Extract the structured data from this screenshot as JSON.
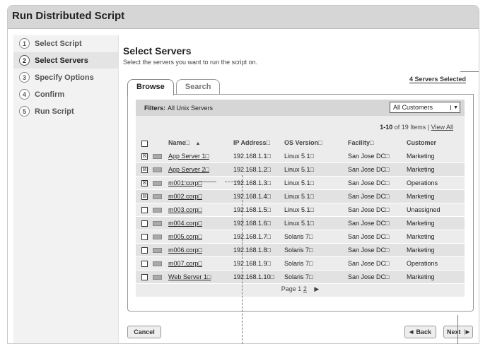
{
  "window": {
    "title": "Run Distributed Script"
  },
  "sidebar": {
    "steps": [
      {
        "num": "1",
        "label": "Select Script"
      },
      {
        "num": "2",
        "label": "Select Servers"
      },
      {
        "num": "3",
        "label": "Specify Options"
      },
      {
        "num": "4",
        "label": "Confirm"
      },
      {
        "num": "5",
        "label": "Run Script"
      }
    ]
  },
  "main": {
    "title": "Select Servers",
    "subtitle": "Select the servers you want to run the script on.",
    "selected_count": "4 Servers Selected",
    "tabs": [
      {
        "label": "Browse"
      },
      {
        "label": "Search"
      }
    ],
    "filter": {
      "label": "Filters:",
      "value": "All Unix Servers",
      "customer_select": "All Customers",
      "customer_arrow": "▼"
    },
    "paging": {
      "range": "1-10",
      "of_text": "of 19 Items",
      "separator": "|",
      "view_all": "View All"
    },
    "columns": {
      "name": "Name□",
      "sort_icon": "▲",
      "ip": "IP Address□",
      "os": "OS Version□",
      "facility": "Facility□",
      "customer": "Customer"
    },
    "rows": [
      {
        "checked": "☒",
        "name": "App Server 1□",
        "ip": "192.168.1.1□",
        "os": "Linux 5.1□",
        "facility": "San Jose DC□",
        "customer": "Marketing"
      },
      {
        "checked": "☒",
        "name": "App Server 2□",
        "ip": "192.168.1.2□",
        "os": "Linux 5.1□",
        "facility": "San Jose DC□",
        "customer": "Marketing"
      },
      {
        "checked": "☒",
        "name": "m001.corp□",
        "ip": "192.168.1.3□",
        "os": "Linux 5.1□",
        "facility": "San Jose DC□",
        "customer": "Operations"
      },
      {
        "checked": "☒",
        "name": "m002.corp□",
        "ip": "192.168.1.4□",
        "os": "Linux 5.1□",
        "facility": "San Jose DC□",
        "customer": "Marketing"
      },
      {
        "checked": "",
        "name": "m003.corp□",
        "ip": "192.168.1.5□",
        "os": "Linux 5.1□",
        "facility": "San Jose DC□",
        "customer": "Unassigned"
      },
      {
        "checked": "",
        "name": "m004.corp□",
        "ip": "192.168.1.6□",
        "os": "Linux 5.1□",
        "facility": "San Jose DC□",
        "customer": "Marketing"
      },
      {
        "checked": "",
        "name": "m005.corp□",
        "ip": "192.168.1.7□",
        "os": "Solaris 7□",
        "facility": "San Jose DC□",
        "customer": "Marketing"
      },
      {
        "checked": "",
        "name": "m006.corp□",
        "ip": "192.168.1.8□",
        "os": "Solaris 7□",
        "facility": "San Jose DC□",
        "customer": "Marketing"
      },
      {
        "checked": "",
        "name": "m007.corp□",
        "ip": "192.168.1.9□",
        "os": "Solaris 7□",
        "facility": "San Jose DC□",
        "customer": "Operations"
      },
      {
        "checked": "",
        "name": "Web Server 1□",
        "ip": "192.168.1.10□",
        "os": "Solaris 7□",
        "facility": "San Jose DC□",
        "customer": "Marketing"
      }
    ],
    "pager": {
      "label": "Page",
      "current": "1",
      "next_page": "2",
      "next_icon": "▶"
    }
  },
  "buttons": {
    "cancel": "Cancel",
    "back": "Back",
    "back_icon": "◀",
    "next": "Next",
    "next_icon": "▶"
  }
}
